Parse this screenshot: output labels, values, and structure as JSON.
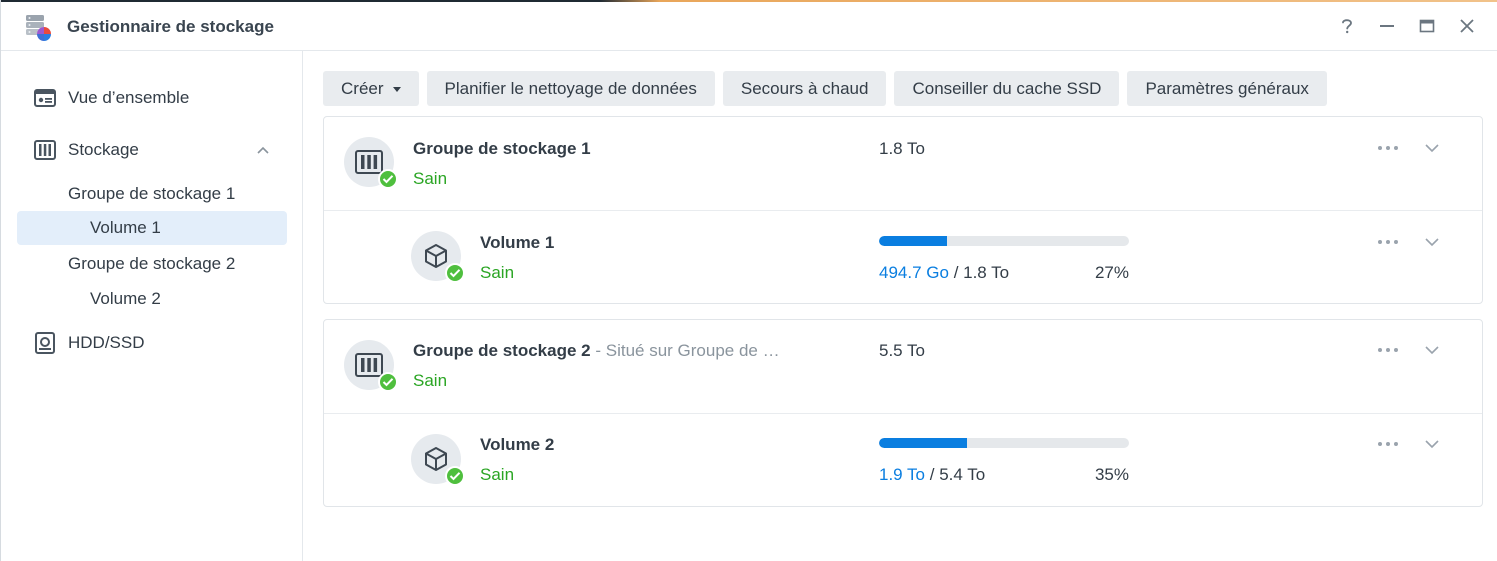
{
  "window": {
    "title": "Gestionnaire de stockage",
    "buttons": [
      "help-icon",
      "minimize-icon",
      "maximize-icon",
      "close-icon"
    ]
  },
  "sidebar": {
    "items": [
      {
        "label": "Vue d’ensemble",
        "icon": "overview-icon"
      },
      {
        "label": "Stockage",
        "icon": "storage-icon",
        "expanded": true
      },
      {
        "label": "Groupe de stockage 1"
      },
      {
        "label": "Volume 1",
        "selected": true
      },
      {
        "label": "Groupe de stockage 2"
      },
      {
        "label": "Volume 2"
      },
      {
        "label": "HDD/SSD",
        "icon": "hdd-icon"
      }
    ]
  },
  "toolbar": {
    "create": "Créer",
    "scrub": "Planifier le nettoyage de données",
    "hotspare": "Secours à chaud",
    "ssd_advisor": "Conseiller du cache SSD",
    "settings": "Paramètres généraux"
  },
  "pools": [
    {
      "name": "Groupe de stockage 1",
      "location": "",
      "status": "Sain",
      "capacity": "1.8 To",
      "volume": {
        "name": "Volume 1",
        "status": "Sain",
        "used": "494.7 Go",
        "total": "/ 1.8 To",
        "percent_label": "27%",
        "percent": 27
      }
    },
    {
      "name": "Groupe de stockage 2",
      "location": " - Situé sur Groupe de …",
      "status": "Sain",
      "capacity": "5.5 To",
      "volume": {
        "name": "Volume 2",
        "status": "Sain",
        "used": "1.9 To",
        "total": "/ 5.4 To",
        "percent_label": "35%",
        "percent": 35
      }
    }
  ],
  "colors": {
    "accent": "#0a7ee0",
    "healthy": "#2aa523",
    "selected_bg": "#e3eefa"
  }
}
